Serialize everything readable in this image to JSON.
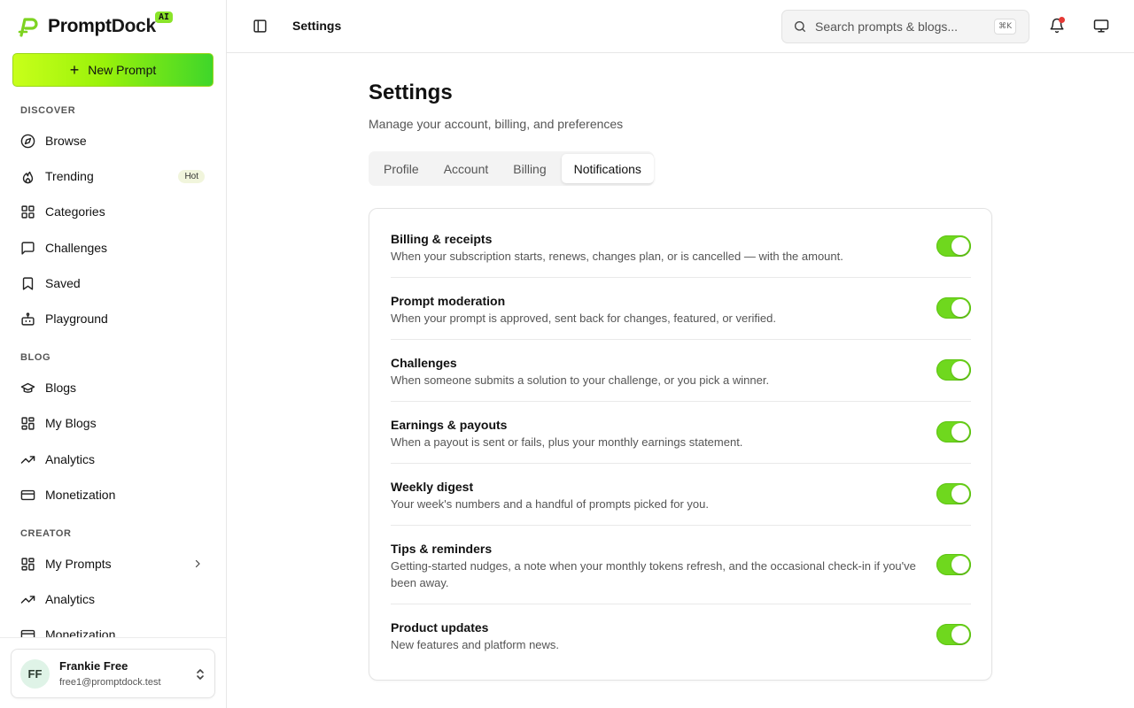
{
  "brand": {
    "name_prompt": "Prompt",
    "name_dock": "Dock",
    "badge": "AI",
    "accent": "#6fd81e"
  },
  "sidebar": {
    "new_prompt_label": "New Prompt",
    "sections": {
      "discover": "DISCOVER",
      "blog": "BLOG",
      "creator": "CREATOR"
    },
    "discover_items": [
      {
        "label": "Browse",
        "icon": "compass-icon"
      },
      {
        "label": "Trending",
        "icon": "flame-icon",
        "badge": "Hot"
      },
      {
        "label": "Categories",
        "icon": "grid-icon"
      },
      {
        "label": "Challenges",
        "icon": "message-square-icon"
      },
      {
        "label": "Saved",
        "icon": "bookmark-icon"
      },
      {
        "label": "Playground",
        "icon": "bot-icon"
      }
    ],
    "blog_items": [
      {
        "label": "Blogs",
        "icon": "graduation-cap-icon"
      },
      {
        "label": "My Blogs",
        "icon": "layout-dashboard-icon"
      },
      {
        "label": "Analytics",
        "icon": "trending-up-icon"
      },
      {
        "label": "Monetization",
        "icon": "credit-card-icon"
      }
    ],
    "creator_items": [
      {
        "label": "My Prompts",
        "icon": "layout-dashboard-icon"
      },
      {
        "label": "Analytics",
        "icon": "trending-up-icon"
      },
      {
        "label": "Monetization",
        "icon": "credit-card-icon"
      }
    ],
    "user": {
      "initials": "FF",
      "name": "Frankie Free",
      "email": "free1@promptdock.test"
    }
  },
  "topbar": {
    "breadcrumb": "Settings",
    "search_placeholder": "Search prompts & blogs...",
    "shortcut": "⌘K"
  },
  "main": {
    "title": "Settings",
    "subtitle": "Manage your account, billing, and preferences",
    "tabs": [
      {
        "label": "Profile",
        "active": false
      },
      {
        "label": "Account",
        "active": false
      },
      {
        "label": "Billing",
        "active": false
      },
      {
        "label": "Notifications",
        "active": true
      }
    ],
    "notifications": [
      {
        "title": "Billing & receipts",
        "desc": "When your subscription starts, renews, changes plan, or is cancelled — with the amount.",
        "enabled": true
      },
      {
        "title": "Prompt moderation",
        "desc": "When your prompt is approved, sent back for changes, featured, or verified.",
        "enabled": true
      },
      {
        "title": "Challenges",
        "desc": "When someone submits a solution to your challenge, or you pick a winner.",
        "enabled": true
      },
      {
        "title": "Earnings & payouts",
        "desc": "When a payout is sent or fails, plus your monthly earnings statement.",
        "enabled": true
      },
      {
        "title": "Weekly digest",
        "desc": "Your week's numbers and a handful of prompts picked for you.",
        "enabled": true
      },
      {
        "title": "Tips & reminders",
        "desc": "Getting-started nudges, a note when your monthly tokens refresh, and the occasional check-in if you've been away.",
        "enabled": true
      },
      {
        "title": "Product updates",
        "desc": "New features and platform news.",
        "enabled": true
      }
    ]
  }
}
